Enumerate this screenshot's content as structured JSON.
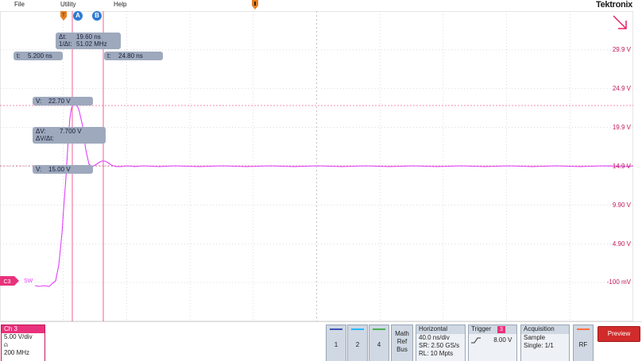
{
  "menu": {
    "file": "File",
    "utility": "Utility",
    "help": "Help"
  },
  "brand": {
    "name": "Tektronix",
    "dot_color": "#0072ce"
  },
  "markers": {
    "a": "A",
    "b": "B"
  },
  "cursors": {
    "delta_t_label": "Δt:",
    "delta_t": "19.60 ns",
    "inv_delta_t_label": "1/Δt:",
    "inv_delta_t": "51.02 MHz",
    "t_a_label": "t:",
    "t_a": "5.200 ns",
    "t_b_label": "t:",
    "t_b": "24.80 ns",
    "v_a_label": "V:",
    "v_a": "22.70 V",
    "delta_v_label": "ΔV:",
    "delta_v": "7.700 V",
    "dv_dt_label": "ΔV/Δt:",
    "v_b_label": "V:",
    "v_b": "15.00 V"
  },
  "scale_labels": [
    "29.9 V",
    "24.9 V",
    "19.9 V",
    "14.9 V",
    "9.90 V",
    "4.90 V",
    "-100 mV"
  ],
  "trace": {
    "label": "SW",
    "color": "#e040fb",
    "channel": "C3"
  },
  "bottom": {
    "ch3": {
      "title": "Ch 3",
      "vdiv": "5.00 V/div",
      "bw_icon": "bandwidth-icon",
      "bw": "200 MHz"
    },
    "buttons": {
      "ch1": "1",
      "ch2": "2",
      "ch4": "4",
      "math": "Math",
      "ref": "Ref",
      "bus": "Bus",
      "rf": "RF",
      "preview": "Preview"
    },
    "horizontal": {
      "title": "Horizontal",
      "scale": "40.0 ns/div",
      "sr": "SR: 2.50 GS/s",
      "rl": "RL: 10 Mpts"
    },
    "trigger": {
      "title": "Trigger",
      "channel": "3",
      "level": "8.00 V",
      "slope_icon": "rising-edge-icon"
    },
    "acquisition": {
      "title": "Acquisition",
      "mode": "Sample",
      "single": "Single: 1/1"
    }
  },
  "colors": {
    "trace": "#e040fb",
    "ch3": "#e9327c",
    "cursor": "#e91e63",
    "ch1": "#3f51b5",
    "ch2": "#29b6f6",
    "ch4": "#4caf50",
    "rf": "#ff7043",
    "preview": "#d12b2b"
  }
}
